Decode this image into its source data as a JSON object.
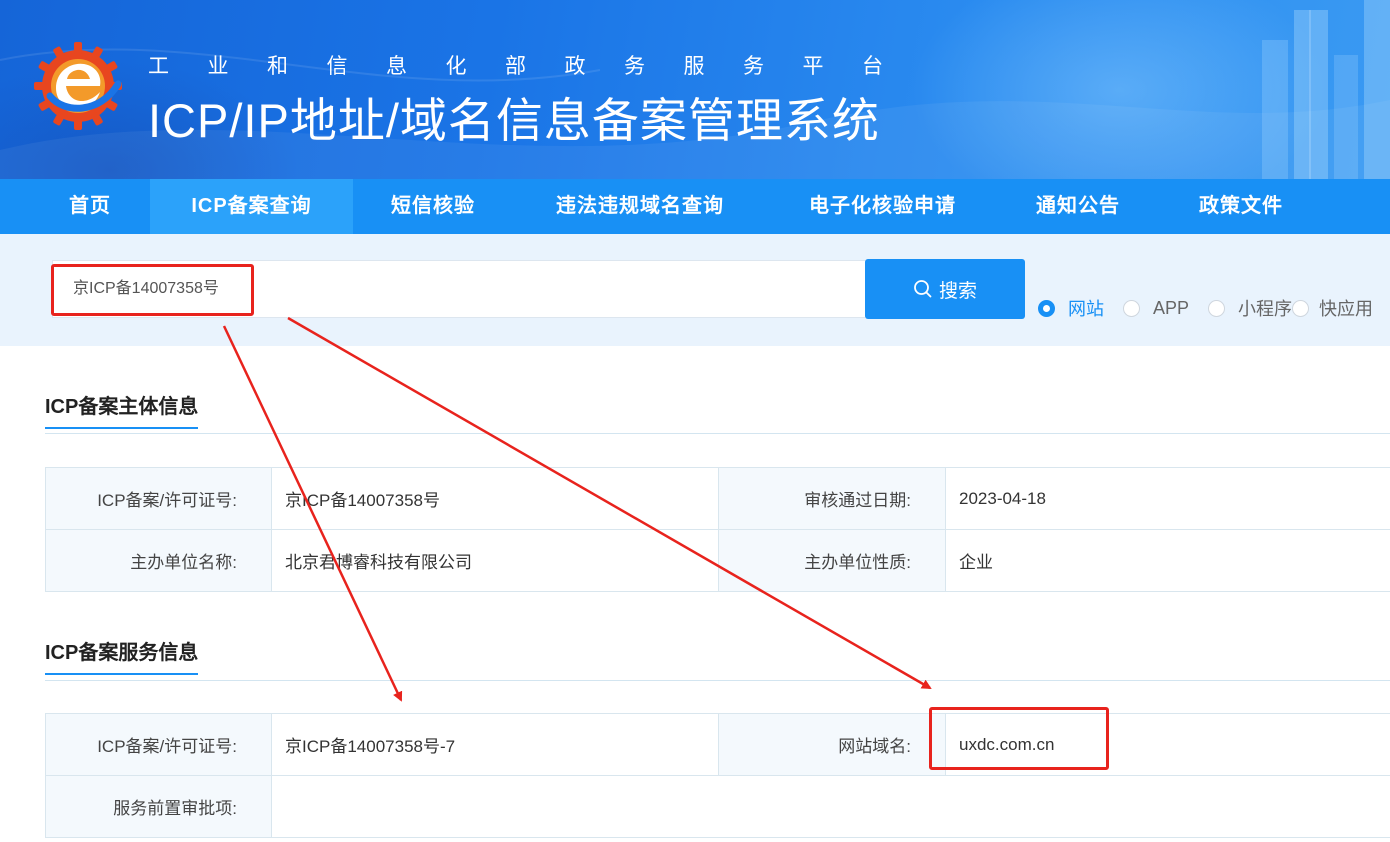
{
  "header": {
    "subtitle": "工业和信息化部政务服务平台",
    "title": "ICP/IP地址/域名信息备案管理系统"
  },
  "nav": {
    "items": [
      {
        "label": "首页",
        "active": false
      },
      {
        "label": "ICP备案查询",
        "active": true
      },
      {
        "label": "短信核验",
        "active": false
      },
      {
        "label": "违法违规域名查询",
        "active": false
      },
      {
        "label": "电子化核验申请",
        "active": false
      },
      {
        "label": "通知公告",
        "active": false
      },
      {
        "label": "政策文件",
        "active": false
      }
    ]
  },
  "search": {
    "value": "京ICP备14007358号",
    "button_label": "搜索",
    "options": [
      {
        "label": "网站",
        "checked": true
      },
      {
        "label": "APP",
        "checked": false
      },
      {
        "label": "小程序",
        "checked": false
      },
      {
        "label": "快应用",
        "checked": false
      }
    ]
  },
  "subject_info": {
    "title": "ICP备案主体信息",
    "license_label": "ICP备案/许可证号:",
    "license_value": "京ICP备14007358号",
    "approve_date_label": "审核通过日期:",
    "approve_date_value": "2023-04-18",
    "org_name_label": "主办单位名称:",
    "org_name_value": "北京君博睿科技有限公司",
    "org_type_label": "主办单位性质:",
    "org_type_value": "企业"
  },
  "service_info": {
    "title": "ICP备案服务信息",
    "license_label": "ICP备案/许可证号:",
    "license_value": "京ICP备14007358号-7",
    "domain_label": "网站域名:",
    "domain_value": "uxdc.com.cn",
    "pre_approval_label": "服务前置审批项:",
    "pre_approval_value": ""
  },
  "colors": {
    "nav_bg": "#1890f5",
    "nav_active": "#2ba2fa",
    "accent": "#1890f5",
    "annotation": "#e8231d"
  }
}
